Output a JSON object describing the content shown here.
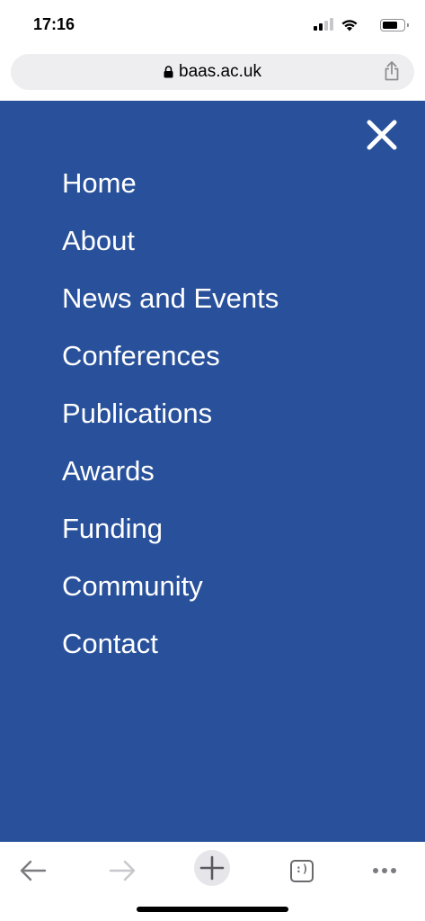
{
  "status_bar": {
    "time": "17:16",
    "icons": [
      "signal-icon",
      "wifi-icon",
      "battery-icon"
    ]
  },
  "browser": {
    "url": "baas.ac.uk",
    "icons": [
      "lock-icon",
      "share-icon"
    ]
  },
  "menu": {
    "background_color": "#29519b",
    "close_icon": "close-icon",
    "items": [
      {
        "label": "Home"
      },
      {
        "label": "About"
      },
      {
        "label": "News and Events"
      },
      {
        "label": "Conferences"
      },
      {
        "label": "Publications"
      },
      {
        "label": "Awards"
      },
      {
        "label": "Funding"
      },
      {
        "label": "Community"
      },
      {
        "label": "Contact"
      }
    ]
  },
  "toolbar": {
    "icons": [
      "back-arrow-icon",
      "forward-arrow-icon",
      "new-tab-plus-icon",
      "tab-switcher-icon",
      "more-dots-icon"
    ],
    "tab_switcher_label": ":)"
  }
}
